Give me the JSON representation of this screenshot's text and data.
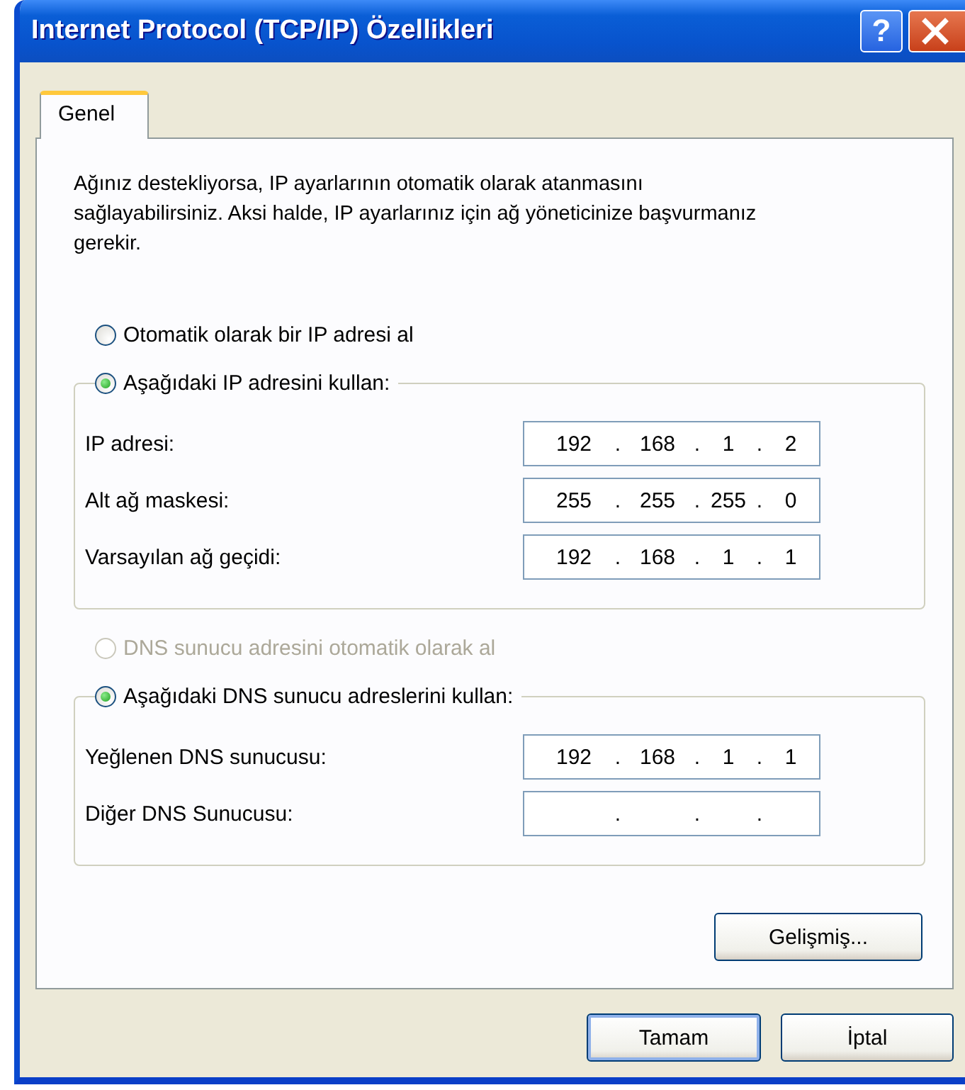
{
  "window": {
    "title": "Internet Protocol (TCP/IP) Özellikleri",
    "help_button": "?"
  },
  "tabs": [
    {
      "label": "Genel",
      "selected": true
    }
  ],
  "description": "Ağınız destekliyorsa, IP ayarlarının otomatik olarak atanmasını sağlayabilirsiniz. Aksi halde, IP ayarlarınız için ağ yöneticinize başvurmanız gerekir.",
  "ip_section": {
    "auto_option": {
      "label": "Otomatik olarak bir IP adresi al",
      "selected": false,
      "disabled": false
    },
    "manual_option": {
      "label": "Aşağıdaki IP adresini kullan:",
      "selected": true,
      "disabled": false
    },
    "fields": [
      {
        "label": "IP adresi:",
        "octets": [
          "192",
          "168",
          "1",
          "2"
        ],
        "dots": [
          ".",
          ".",
          "."
        ]
      },
      {
        "label": "Alt ağ maskesi:",
        "octets": [
          "255",
          "255",
          "255",
          "0"
        ],
        "dots": [
          ".",
          ".",
          "."
        ]
      },
      {
        "label": "Varsayılan ağ geçidi:",
        "octets": [
          "192",
          "168",
          "1",
          "1"
        ],
        "dots": [
          ".",
          ".",
          "."
        ]
      }
    ]
  },
  "dns_section": {
    "auto_option": {
      "label": "DNS sunucu adresini otomatik olarak al",
      "selected": false,
      "disabled": true
    },
    "manual_option": {
      "label": "Aşağıdaki DNS sunucu adreslerini kullan:",
      "selected": true,
      "disabled": false
    },
    "fields": [
      {
        "label": "Yeğlenen DNS sunucusu:",
        "octets": [
          "192",
          "168",
          "1",
          "1"
        ],
        "dots": [
          ".",
          ".",
          "."
        ]
      },
      {
        "label": "Diğer DNS Sunucusu:",
        "dots": [
          ".",
          ".",
          "."
        ]
      }
    ]
  },
  "advanced_button": "Gelişmiş...",
  "buttons": [
    {
      "label": "Tamam",
      "default": true
    },
    {
      "label": "İptal",
      "default": false
    }
  ]
}
